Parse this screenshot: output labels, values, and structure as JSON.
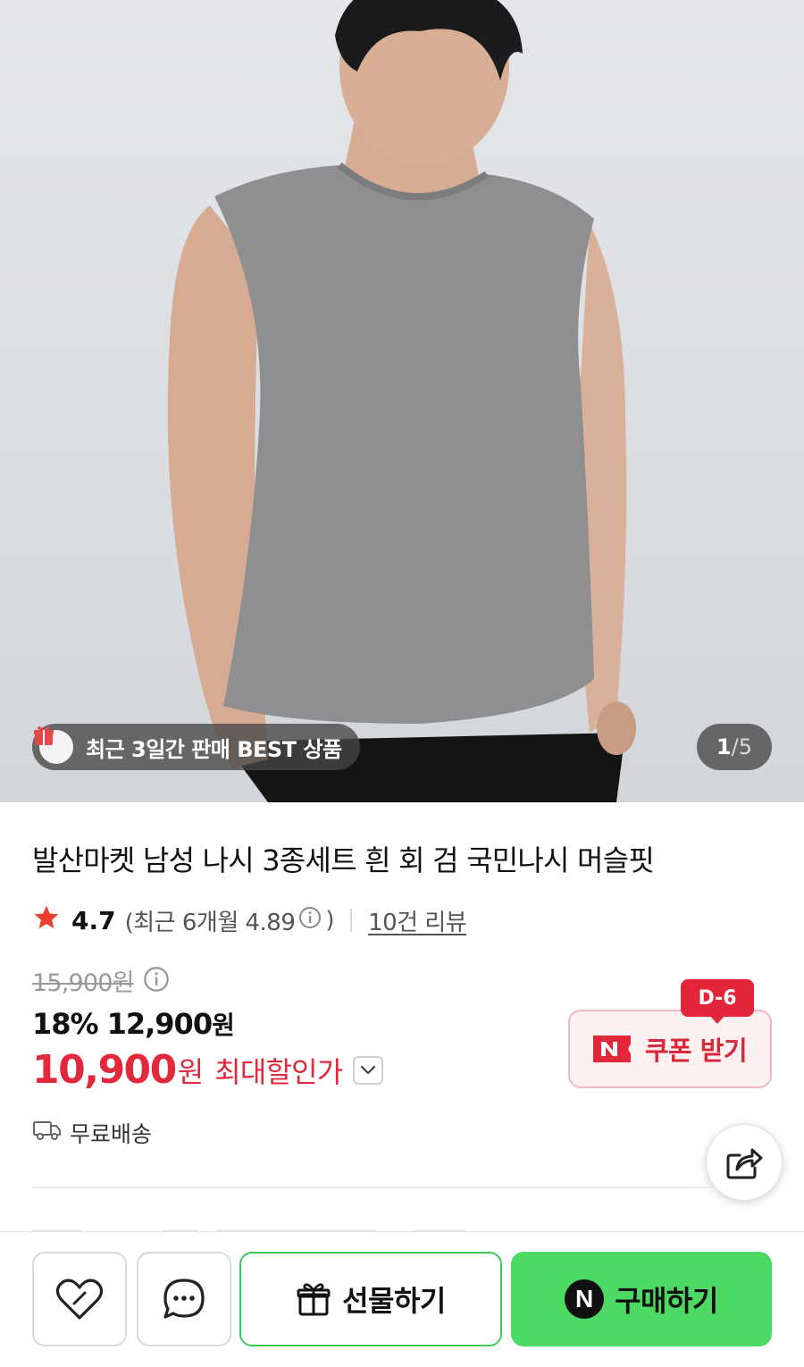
{
  "gallery": {
    "badge_text": "최근 3일간 판매 BEST 상품",
    "current_index": "1",
    "separator": "/",
    "total": "5"
  },
  "product": {
    "title": "발산마켓 남성 나시 3종세트 흰 회 검 국민나시 머슬핏",
    "rating": "4.7",
    "recent_rating_prefix": "(최근 6개월 4.89",
    "recent_rating_suffix": ")",
    "review_link": "10건 리뷰"
  },
  "price": {
    "original": "15,900원",
    "discount_percent": "18%",
    "discounted": "12,900",
    "discounted_unit": "원",
    "final": "10,900",
    "final_unit": "원",
    "final_label": "최대할인가"
  },
  "coupon": {
    "dday": "D-6",
    "label": "쿠폰 받기"
  },
  "shipping": {
    "label": "무료배송"
  },
  "bottom_bar": {
    "gift_label": "선물하기",
    "buy_badge": "N",
    "buy_label": "구매하기"
  },
  "icons": {
    "star": "star-icon",
    "info": "info-icon",
    "gift": "gift-icon",
    "truck": "truck-icon",
    "share": "share-icon",
    "heart": "heart-icon",
    "chat": "chat-icon",
    "chevron": "chevron-down-icon"
  },
  "colors": {
    "accent_red": "#e2283c",
    "naver_green": "#4cd964",
    "star_red": "#e8402c"
  }
}
